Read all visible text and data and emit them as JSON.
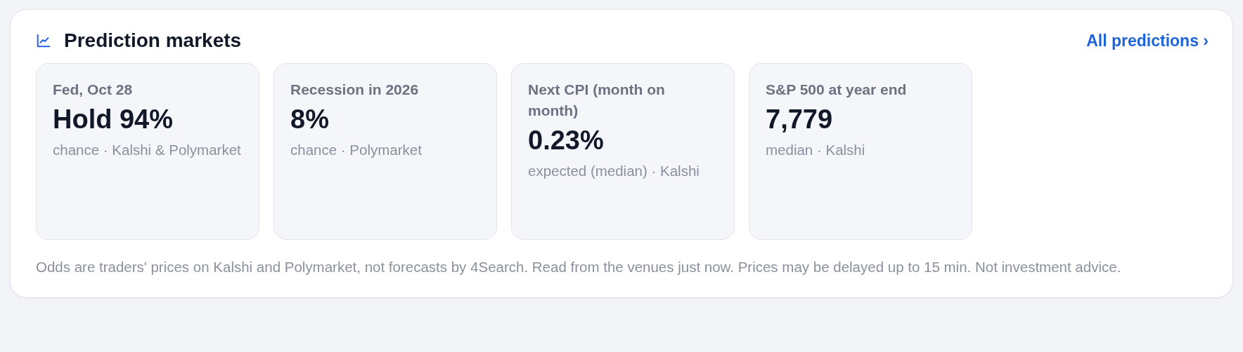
{
  "header": {
    "title": "Prediction markets",
    "link": "All predictions ›"
  },
  "markets": [
    {
      "label": "Fed, Oct 28",
      "value": "Hold 94%",
      "note": "chance · Kalshi & Polymarket"
    },
    {
      "label": "Recession in 2026",
      "value": "8%",
      "note": "chance · Polymarket"
    },
    {
      "label": "Next CPI (month on month)",
      "value": "0.23%",
      "note": "expected (median) · Kalshi"
    },
    {
      "label": "S&P 500 at year end",
      "value": "7,779",
      "note": "median · Kalshi"
    }
  ],
  "disclaimer": "Odds are traders' prices on Kalshi and Polymarket, not forecasts by 4Search. Read from the venues just now. Prices may be delayed up to 15 min. Not investment advice."
}
